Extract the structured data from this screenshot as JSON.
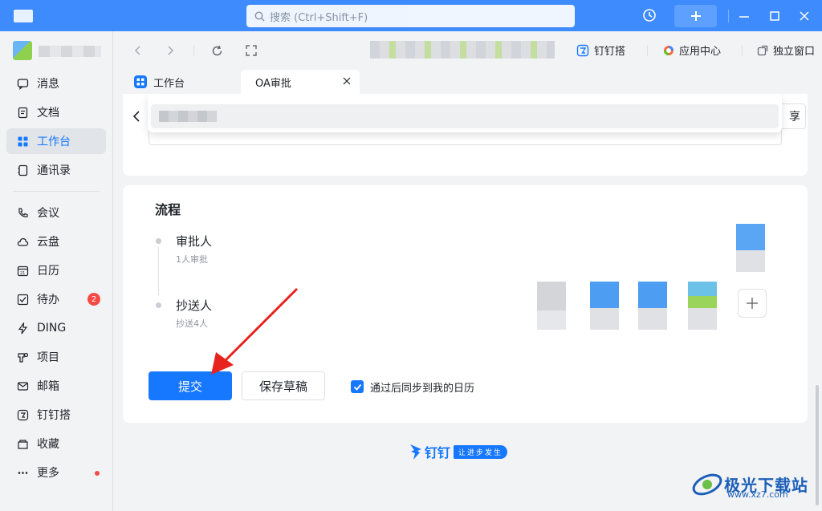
{
  "titlebar": {
    "search_placeholder": "搜索 (Ctrl+Shift+F)"
  },
  "sidebar": {
    "items": [
      {
        "label": "消息",
        "icon": "message-icon"
      },
      {
        "label": "文档",
        "icon": "document-icon"
      },
      {
        "label": "工作台",
        "icon": "workbench-icon",
        "active": true
      },
      {
        "label": "通讯录",
        "icon": "contacts-icon"
      },
      {
        "label": "会议",
        "icon": "phone-icon"
      },
      {
        "label": "云盘",
        "icon": "cloud-icon"
      },
      {
        "label": "日历",
        "icon": "calendar-icon"
      },
      {
        "label": "待办",
        "icon": "todo-icon",
        "badge": "2"
      },
      {
        "label": "DING",
        "icon": "ding-icon"
      },
      {
        "label": "项目",
        "icon": "project-icon"
      },
      {
        "label": "邮箱",
        "icon": "mail-icon"
      },
      {
        "label": "钉钉搭",
        "icon": "builder-icon"
      },
      {
        "label": "收藏",
        "icon": "favorites-icon"
      },
      {
        "label": "更多",
        "icon": "more-icon",
        "dot": true
      }
    ]
  },
  "browserbar": {
    "links": [
      "钉钉搭",
      "应用中心",
      "独立窗口"
    ]
  },
  "tabs": [
    {
      "label": "工作台"
    },
    {
      "label": "OA审批",
      "active": true
    }
  ],
  "card1": {
    "share_label": "享"
  },
  "process": {
    "title": "流程",
    "approver": {
      "title": "审批人",
      "subtitle": "1人审批"
    },
    "cc": {
      "title": "抄送人",
      "subtitle": "抄送4人"
    }
  },
  "actions": {
    "submit": "提交",
    "save_draft": "保存草稿",
    "sync_calendar": "通过后同步到我的日历",
    "sync_checked": true
  },
  "footer": {
    "brand": "钉钉",
    "slogan": "让进步发生"
  },
  "watermark": {
    "title": "极光下载站",
    "url": "www.xz7.com"
  },
  "colors": {
    "accent": "#1677ff",
    "titlebar": "#3d8bfd",
    "badge": "#f54a45"
  }
}
